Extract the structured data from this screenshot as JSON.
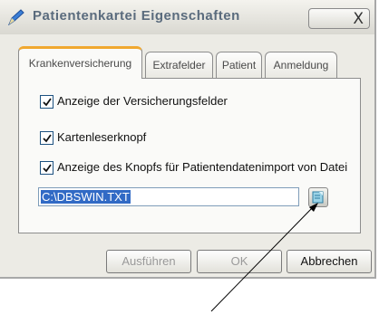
{
  "window": {
    "title": "Patientenkartei Eigenschaften",
    "icon": "pencil-icon",
    "close_icon": "close-icon",
    "close_symbol": "X"
  },
  "tabs": [
    {
      "label": "Krankenversicherung",
      "active": true
    },
    {
      "label": "Extrafelder",
      "active": false
    },
    {
      "label": "Patient",
      "active": false
    },
    {
      "label": "Anmeldung",
      "active": false
    }
  ],
  "panel": {
    "checkboxes": [
      {
        "label": "Anzeige der Versicherungsfelder",
        "checked": true
      },
      {
        "label": "Kartenleserknopf",
        "checked": true
      },
      {
        "label": "Anzeige des Knopfs für Patientendatenimport von Datei",
        "checked": true
      }
    ],
    "import_path": "C:\\DBSWIN.TXT",
    "browse_icon": "browse-file-icon"
  },
  "buttons": {
    "apply": "Ausführen",
    "ok": "OK",
    "cancel": "Abbrechen"
  },
  "colors": {
    "title_text": "#5a6b7d",
    "active_tab_accent": "#f0a830",
    "selection": "#316ac5",
    "dialog_bg": "#ecebe5"
  }
}
